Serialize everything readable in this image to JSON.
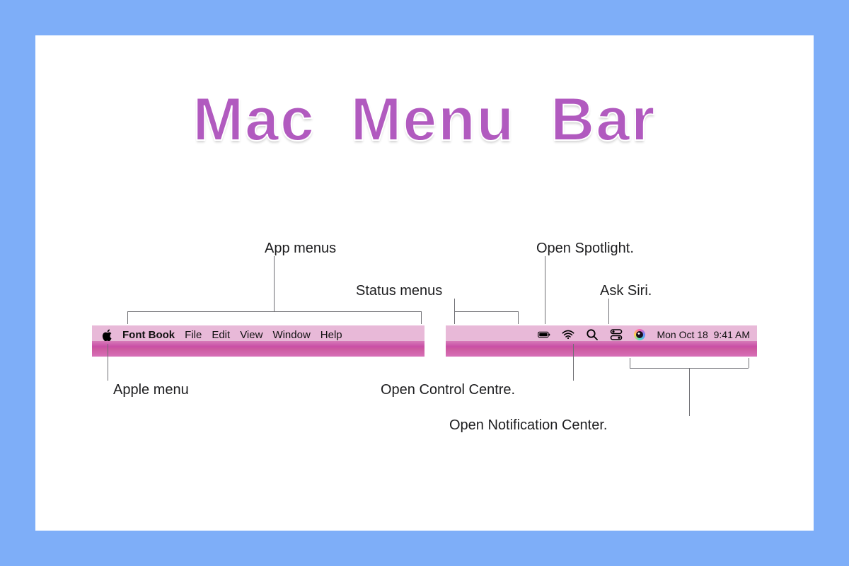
{
  "title": "Mac Menu Bar",
  "menubar": {
    "app_name": "Font Book",
    "menus": [
      "File",
      "Edit",
      "View",
      "Window",
      "Help"
    ],
    "date": "Mon Oct 18",
    "time": "9:41 AM"
  },
  "callouts": {
    "apple_menu": "Apple menu",
    "app_menus": "App menus",
    "status_menus": "Status menus",
    "open_spotlight": "Open Spotlight.",
    "ask_siri": "Ask Siri.",
    "open_control_centre": "Open Control Centre.",
    "open_notification_center": "Open Notification Center."
  },
  "icons": {
    "apple": "apple-logo-icon",
    "battery": "battery-icon",
    "wifi": "wifi-icon",
    "spotlight": "magnifier-icon",
    "control_centre": "control-centre-icon",
    "siri": "siri-icon"
  }
}
